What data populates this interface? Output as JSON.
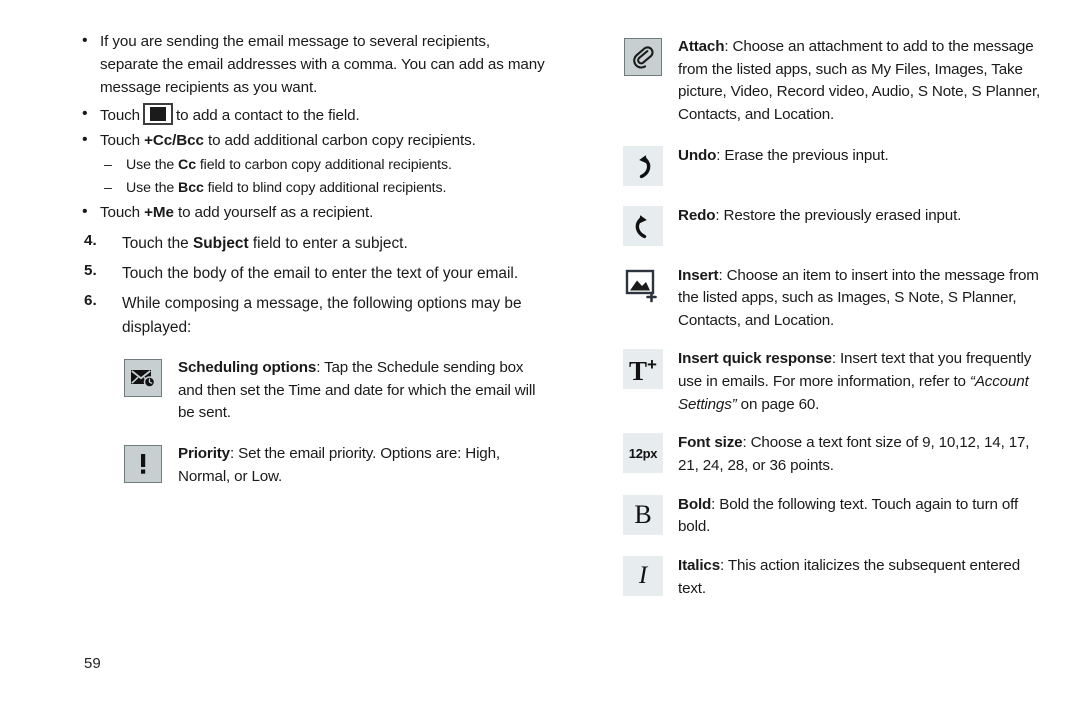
{
  "document": {
    "page_number": "59"
  },
  "left_column": {
    "bullets": [
      {
        "marker": "•",
        "text": "If you are sending the email message to several recipients, separate the email addresses with a comma. You can add as many message recipients as you want."
      }
    ],
    "touch_contact": {
      "marker": "•",
      "prefix": "Touch",
      "icon": "contact-picker-icon",
      "suffix": "to add a contact to the field."
    },
    "cc_bcc": {
      "marker": "•",
      "prefix": "Touch ",
      "bold": "+Cc/Bcc",
      "suffix": " to add additional carbon copy recipients."
    },
    "sub_items": [
      {
        "marker": "–",
        "prefix": "Use the ",
        "bold": "Cc",
        "suffix": " field to carbon copy additional recipients."
      },
      {
        "marker": "–",
        "prefix": "Use the ",
        "bold": "Bcc",
        "suffix": " field to blind copy additional recipients."
      }
    ],
    "me": {
      "marker": "•",
      "prefix": "Touch ",
      "bold": "+Me",
      "suffix": " to add yourself as a recipient."
    },
    "steps": [
      {
        "num": "4.",
        "prefix": "Touch the ",
        "bold": "Subject",
        "suffix": " field to enter a subject."
      },
      {
        "num": "5.",
        "prefix": "Touch the body of the email to enter the text of your email.",
        "bold": "",
        "suffix": ""
      },
      {
        "num": "6.",
        "prefix": "While composing a message, the following options may be displayed:",
        "bold": "",
        "suffix": ""
      }
    ],
    "options": [
      {
        "icon": "schedule-email-icon",
        "title": "Scheduling options",
        "body": ": Tap the Schedule sending box and then set the Time and date for which the email will be sent."
      },
      {
        "icon": "priority-exclamation-icon",
        "title": "Priority",
        "body": ": Set the email priority. Options are: High, Normal, or Low."
      }
    ]
  },
  "right_column": {
    "options": [
      {
        "icon": "paperclip-attach-icon",
        "title": "Attach",
        "body": ": Choose an attachment to add to the message from the listed apps, such as My Files, Images, Take picture, Video, Record video, Audio, S Note, S Planner, Contacts, and Location."
      },
      {
        "icon": "undo-arrow-icon",
        "title": "Undo",
        "body": ": Erase the previous input."
      },
      {
        "icon": "redo-arrow-icon",
        "title": "Redo",
        "body": ": Restore the previously erased input."
      },
      {
        "icon": "insert-image-plus-icon",
        "title": "Insert",
        "body": ": Choose an item to insert into the message from the listed apps, such as Images, S Note, S Planner, Contacts, and Location."
      },
      {
        "icon": "insert-quick-response-icon",
        "title": "Insert quick response",
        "body": ": Insert text that you frequently use in emails. For more information, refer to ",
        "italic": "“Account Settings”",
        "body_tail": " on page 60."
      },
      {
        "icon": "font-size-icon",
        "icon_label": "12px",
        "title": "Font size",
        "body": ": Choose a text font size of 9, 10,12, 14, 17, 21, 24, 28, or 36 points."
      },
      {
        "icon": "bold-icon",
        "icon_label": "B",
        "title": "Bold",
        "body": ": Bold the following text. Touch again to turn off bold."
      },
      {
        "icon": "italics-icon",
        "icon_label": "I",
        "title": "Italics",
        "body": ": This action italicizes the subsequent entered text."
      }
    ]
  },
  "colors": {
    "icon_gray_fill": "#c8cfd1",
    "icon_gray_border": "#6f7b7e",
    "icon_pale_fill": "#e7edee",
    "text": "#1a1a1a"
  }
}
